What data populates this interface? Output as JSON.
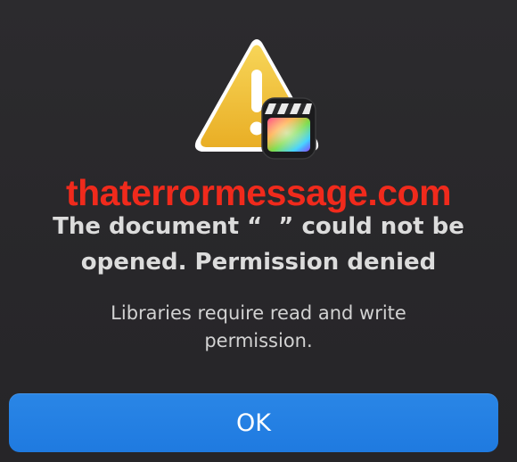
{
  "watermark": "thaterrormessage.com",
  "dialog": {
    "title_line1": "The document “  ” could not be",
    "title_line2": "opened. Permission denied",
    "message_line1": "Libraries require read and write",
    "message_line2": "permission.",
    "ok_label": "OK"
  },
  "icons": {
    "alert": "warning-triangle-icon",
    "badge": "final-cut-pro-icon"
  },
  "colors": {
    "background": "#29282b",
    "button": "#2180e4",
    "watermark": "#f02a1c",
    "warning": "#f3c43a"
  }
}
